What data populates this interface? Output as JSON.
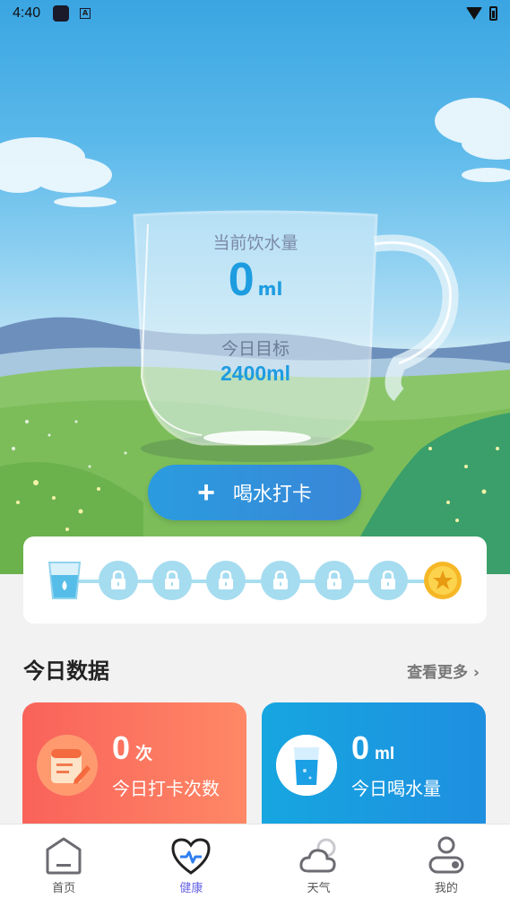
{
  "status_bar": {
    "time": "4:40",
    "icon_letter": "A"
  },
  "hero": {
    "current_label": "当前饮水量",
    "current_value": "0",
    "current_unit": "ml",
    "goal_label": "今日目标",
    "goal_value": "2400ml",
    "checkin_button": {
      "icon": "plus-icon",
      "label": "喝水打卡"
    }
  },
  "progress": {
    "completed": 1,
    "total_steps": 8,
    "nodes": [
      "glass-icon",
      "lock-icon",
      "lock-icon",
      "lock-icon",
      "lock-icon",
      "lock-icon",
      "lock-icon",
      "star-icon"
    ]
  },
  "today": {
    "title": "今日数据",
    "more": "查看更多",
    "checkins": {
      "value": "0",
      "unit": "次",
      "label": "今日打卡次数",
      "icon": "note-pen-icon"
    },
    "intake": {
      "value": "0",
      "unit": "ml",
      "label": "今日喝水量",
      "icon": "water-glass-icon"
    }
  },
  "nav": {
    "items": [
      {
        "label": "首页",
        "icon": "home-icon"
      },
      {
        "label": "健康",
        "icon": "heart-pulse-icon",
        "active": true
      },
      {
        "label": "天气",
        "icon": "cloud-icon"
      },
      {
        "label": "我的",
        "icon": "profile-icon"
      }
    ]
  },
  "colors": {
    "accent": "#1e9ce0",
    "active_nav": "#6a66e6",
    "card_red": "#f9625a",
    "card_blue": "#16a6e0"
  }
}
